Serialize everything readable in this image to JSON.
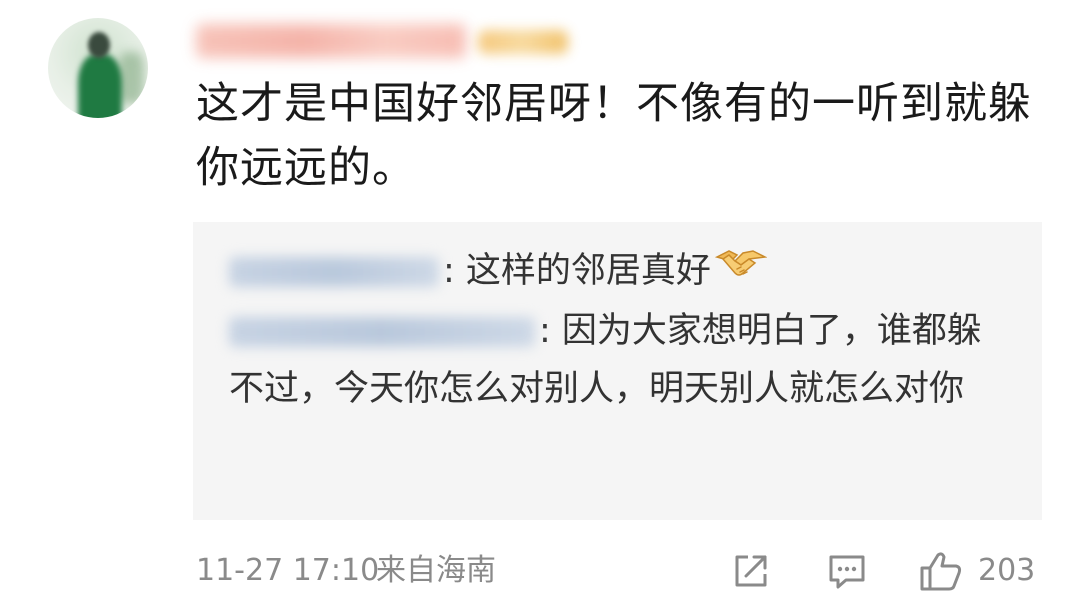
{
  "comment": {
    "text": "这才是中国好邻居呀！不像有的一听到就躲你远远的。"
  },
  "replies": [
    {
      "text": ": 这样的邻居真好",
      "emoji": "handshake-emoji"
    },
    {
      "text": ": 因为大家想明白了，谁都躲不过，今天你怎么对别人，明天别人就怎么对你"
    }
  ],
  "footer": {
    "time": "11-27 17:10",
    "source": "来自海南",
    "like_count": "203"
  },
  "icons": {
    "share": "share-icon",
    "reply": "comment-icon",
    "like": "thumbs-up-icon"
  },
  "colors": {
    "text": "#1a1a1a",
    "reply_bg": "#f5f5f5",
    "meta": "#8a8a8a"
  }
}
